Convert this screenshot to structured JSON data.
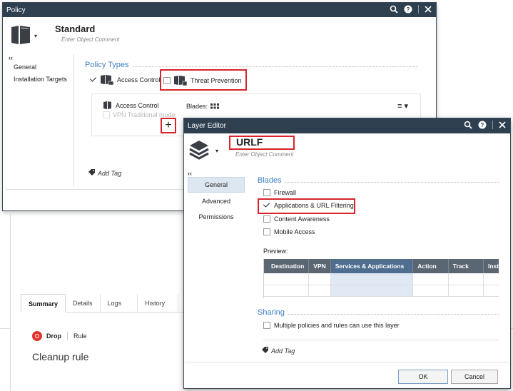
{
  "background": {
    "tabs": [
      "Summary",
      "Details",
      "Logs",
      "History"
    ],
    "action": "Drop",
    "rule_word": "Rule",
    "rule_title": "Cleanup rule"
  },
  "policy": {
    "title": "Policy",
    "object_name": "Standard",
    "object_comment": "Enter Object Comment",
    "collapse_glyph": "‹‹",
    "nav": [
      "General",
      "Installation Targets"
    ],
    "section_title": "Policy Types",
    "access_control_label": "Access Control",
    "threat_prevention_label": "Threat Prevention",
    "panel": {
      "layer_name": "Access Control",
      "vpn_label": "VPN Traditional mode",
      "blades_label": "Blades:",
      "menu_glyph": "≡ ▾"
    },
    "plus_glyph": "+",
    "add_tag": "Add Tag",
    "access_control_checked": true,
    "threat_prevention_checked": false
  },
  "layer_editor": {
    "title": "Layer Editor",
    "object_name": "URLF",
    "object_comment": "Enter Object Comment",
    "collapse_glyph": "‹‹",
    "nav": [
      {
        "label": "General",
        "active": true
      },
      {
        "label": "Advanced",
        "active": false
      },
      {
        "label": "Permissions",
        "active": false
      }
    ],
    "blades_title": "Blades",
    "blades": [
      {
        "label": "Firewall",
        "checked": false
      },
      {
        "label": "Applications & URL Filtering",
        "checked": true
      },
      {
        "label": "Content Awareness",
        "checked": false
      },
      {
        "label": "Mobile Access",
        "checked": false
      }
    ],
    "preview_label": "Preview:",
    "preview_columns": [
      "Destination",
      "VPN",
      "Services & Applications",
      "Action",
      "Track",
      "Instal"
    ],
    "sharing_title": "Sharing",
    "sharing_option": "Multiple policies and rules can use this layer",
    "sharing_checked": false,
    "add_tag": "Add Tag",
    "ok_label": "OK",
    "cancel_label": "Cancel"
  },
  "colors": {
    "titlebar": "#2e3f50",
    "accent_blue": "#3d7fc1",
    "highlight_red": "#d6252b",
    "drop_red": "#e5322f"
  },
  "icons": [
    "search-icon",
    "help-icon",
    "close-icon",
    "book-icon",
    "layers-icon",
    "grid-icon",
    "tag-icon",
    "drop-icon"
  ]
}
